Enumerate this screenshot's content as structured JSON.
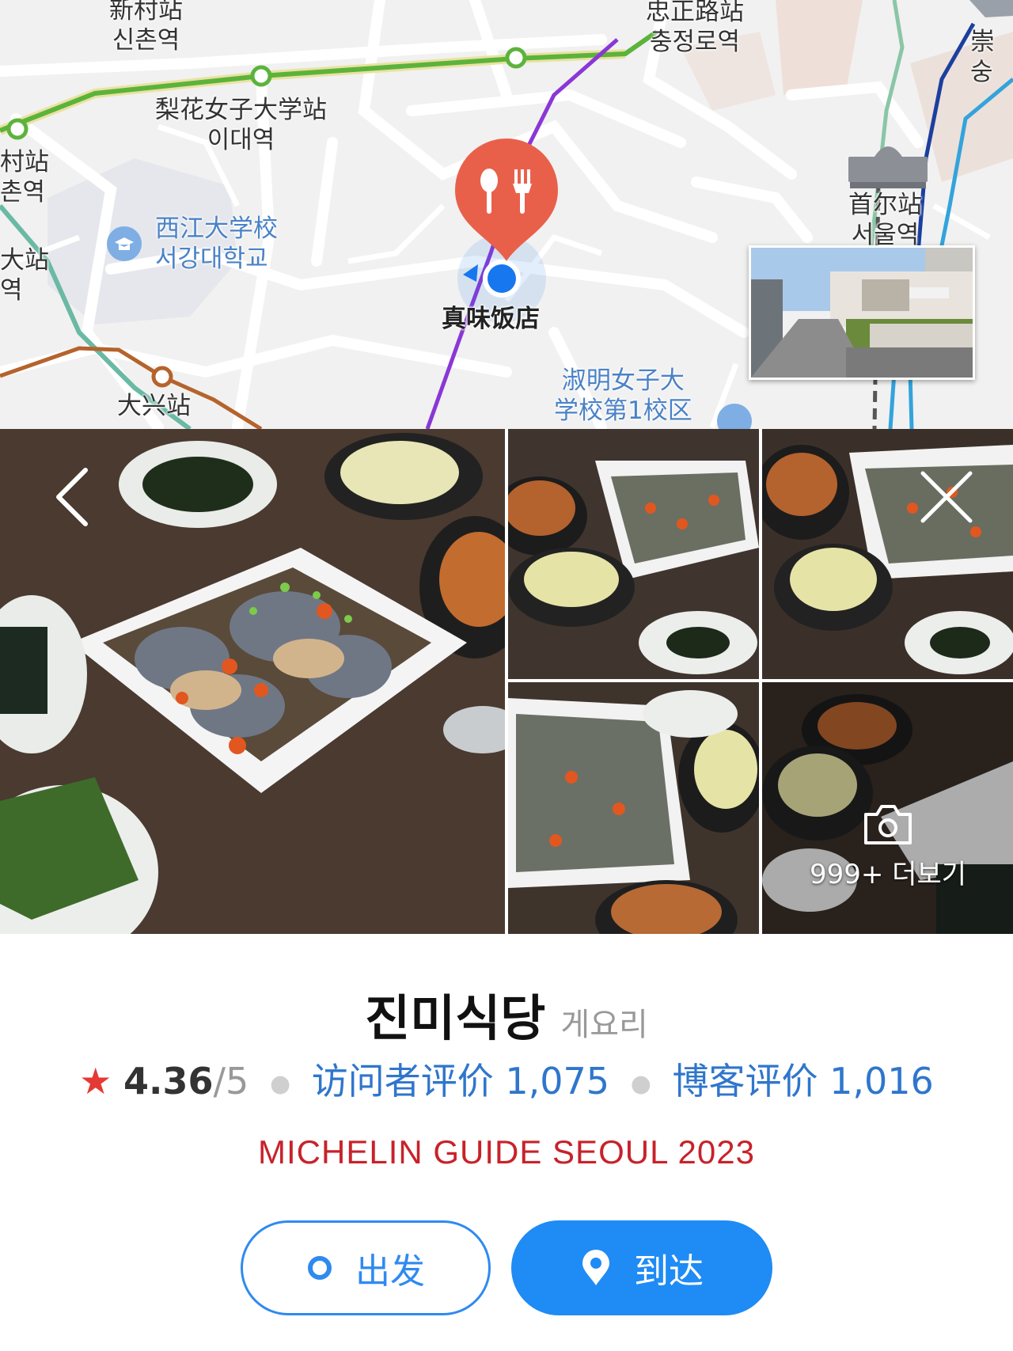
{
  "map": {
    "labels": {
      "sinchon_station_cn": "新村站",
      "sinchon_station_kr": "신촌역",
      "ewha_station_cn": "梨花女子大学站",
      "ewha_station_kr": "이대역",
      "sinchon2_cn": "村站",
      "sinchon2_kr": "촌역",
      "sogang_cn": "西江大学校",
      "sogang_kr": "서강대학교",
      "left_station_cn": "大站",
      "left_station_kr": "역",
      "daeheung_station_cn": "大兴站",
      "chungjeongno_cn": "忠正路站",
      "chungjeongno_kr": "충정로역",
      "sookmyung_line1": "淑明女子大",
      "sookmyung_line2": "学校第1校区",
      "seoul_station_cn": "首尔站",
      "seoul_station_kr": "서울역",
      "sungnye_cn": "崇",
      "sungnye_kr": "숭",
      "restaurant_marker": "真味饭店"
    },
    "colors": {
      "line2_green": "#5cb33c",
      "gyeongui_teal": "#6ab9a4",
      "line6_brown": "#b5632c",
      "line5_purple": "#8a37d6",
      "line1_blue": "#1c3f9e",
      "line4_lightblue": "#33a3dc",
      "marker_red": "#e9604a",
      "location_blue": "#1677ef"
    }
  },
  "photos": {
    "more_label": "999+ 더보기",
    "back_icon": "chevron-left-icon",
    "close_icon": "close-icon",
    "camera_icon": "camera-icon"
  },
  "place": {
    "name": "진미식당",
    "category": "게요리",
    "rating_icon": "star-icon",
    "rating": "4.36",
    "rating_max": "/5",
    "visitor_reviews": "访问者评价 1,075",
    "blog_reviews": "博客评价 1,016",
    "award": "MICHELIN GUIDE SEOUL 2023"
  },
  "actions": {
    "depart_label": "出发",
    "arrive_label": "到达",
    "accent": "#1f8bf5"
  }
}
